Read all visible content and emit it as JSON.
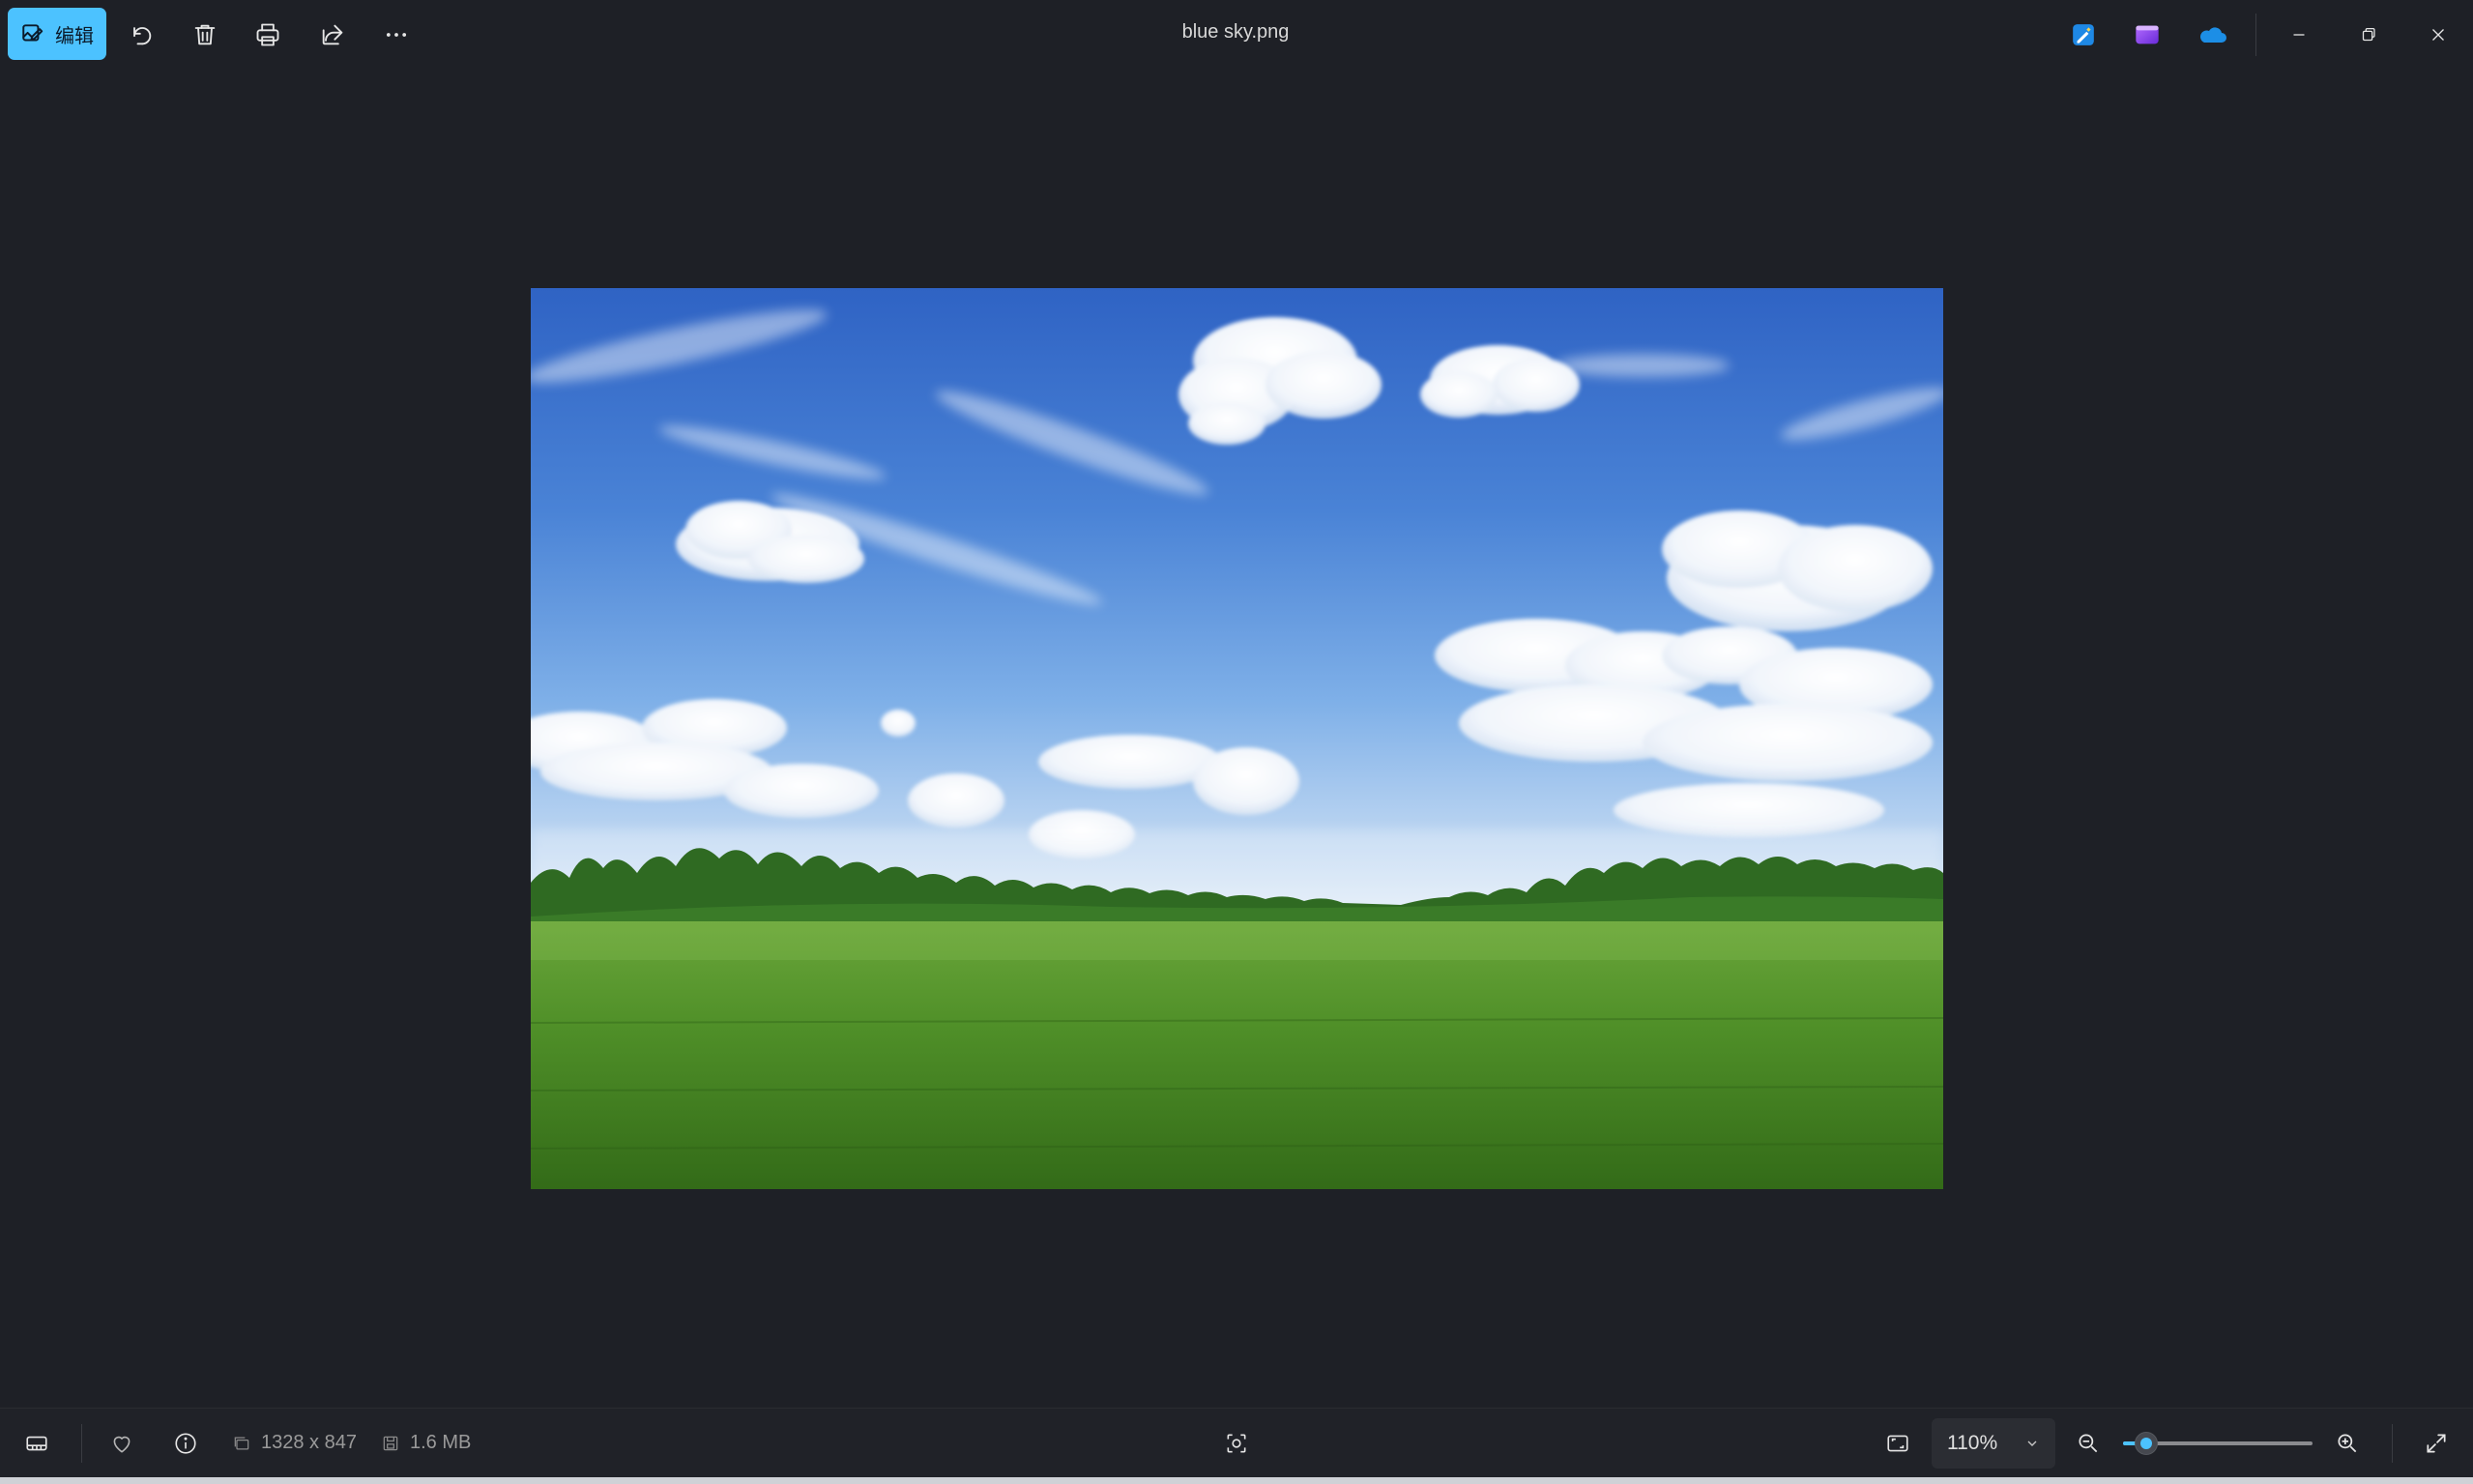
{
  "window": {
    "title": "blue sky.png"
  },
  "toolbar": {
    "edit_label": "编辑",
    "icons": {
      "edit": "image-edit-icon",
      "rotate": "rotate-icon",
      "delete": "trash-icon",
      "print": "printer-icon",
      "share": "share-icon",
      "more": "more-icon"
    }
  },
  "apps": [
    "paint-app-icon",
    "clipchamp-app-icon",
    "onedrive-cloud-icon"
  ],
  "window_controls": [
    "minimize-icon",
    "restore-icon",
    "close-icon"
  ],
  "status": {
    "dimensions": "1328 x 847",
    "file_size": "1.6 MB",
    "zoom_label": "110%",
    "zoom_slider_level": 0.12
  },
  "colors": {
    "accent": "#4cc2ff",
    "background": "#1e2026",
    "bar": "#202228"
  }
}
